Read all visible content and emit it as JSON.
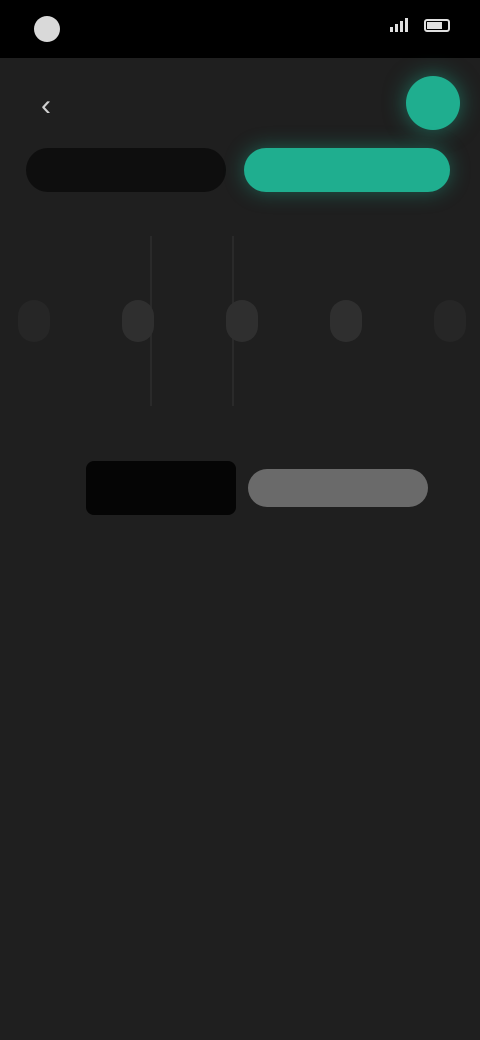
{
  "status_bar": {
    "logo_letter": "",
    "carrier": "",
    "time": ""
  },
  "header": {
    "back_symbol": "‹",
    "title": "",
    "fab_symbol": ""
  },
  "mode_selector": {
    "options": [
      {
        "label": "",
        "active": false
      },
      {
        "label": "",
        "active": true
      }
    ]
  },
  "chips": [
    {
      "label": ""
    },
    {
      "label": ""
    },
    {
      "label": ""
    },
    {
      "label": ""
    },
    {
      "label": ""
    }
  ],
  "action_row": {
    "label": "",
    "input_value": "",
    "input_placeholder": "",
    "button_label": ""
  },
  "colors": {
    "background": "#1f1f1f",
    "accent": "#1fae8f",
    "status_bar": "#000000"
  }
}
